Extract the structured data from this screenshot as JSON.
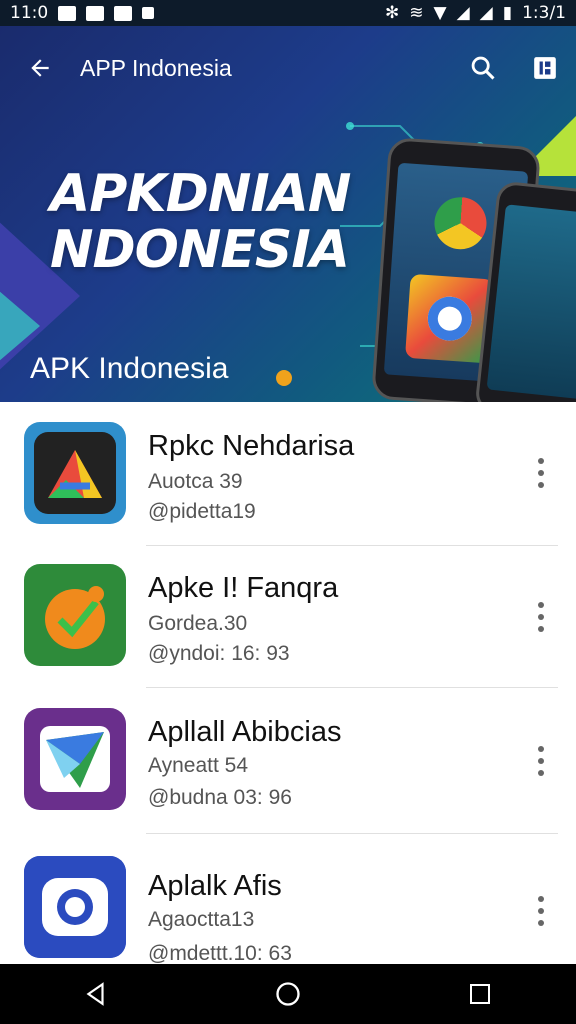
{
  "status_bar": {
    "time_left": "11:0",
    "time_right": "1:3/1"
  },
  "app_bar": {
    "title": "APP Indonesia",
    "back_icon": "arrow-left-icon",
    "search_icon": "search-icon",
    "menu_icon": "app-icon"
  },
  "hero": {
    "headline_line1": "APKDNIAN",
    "headline_line2": "NDONESIA",
    "subtitle": "APK Indonesia"
  },
  "apps": [
    {
      "name": "Rpkc Nehdarisa",
      "line2": "Auotca 39",
      "line3": "@pidetta19",
      "icon": "triangle-app-icon"
    },
    {
      "name": "Apke I! Fanqra",
      "line2": "Gordea.30",
      "line3": "@yndoi: 16: 93",
      "icon": "fruit-app-icon"
    },
    {
      "name": "Apllall Abibcias",
      "line2": "Ayneatt 54",
      "line3": "@budna 03: 96",
      "icon": "arrow-app-icon"
    },
    {
      "name": "Aplalk Afis",
      "line2": "Agaoctta13",
      "line3": "@mdettt.10: 63",
      "icon": "camera-app-icon"
    }
  ],
  "colors": {
    "hero_start": "#1a2b6d",
    "hero_end": "#0e7a78",
    "icon1_bg": "#2f8fcc",
    "icon2_bg": "#2e8b3a",
    "icon3_bg": "#6a2f8c",
    "icon4_bg": "#2b4bbf"
  }
}
